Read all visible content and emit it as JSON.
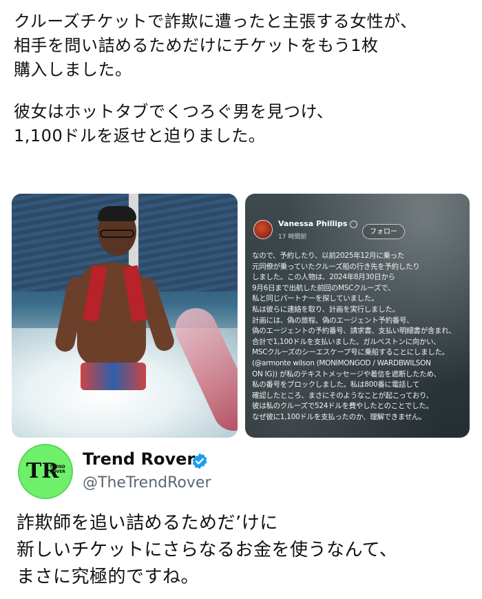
{
  "headline": {
    "lines": [
      "クルーズチケットで詐欺に遭ったと主張する女性が、",
      "相手を問い詰めるためだけにチケットをもう1枚",
      "購入しました。"
    ],
    "lines2": [
      "彼女はホットタブでくつろぐ男を見つけ、",
      "1,100ドルを返せと迫りました。"
    ]
  },
  "fb_post": {
    "author": "Vanessa Phillips",
    "time": "17 時間前",
    "follow_label": "フォロー",
    "lines": [
      "なので、予約したり、以前2025年12月に乗った",
      "元同僚が乗っていたクルーズ船の行き先を予約したり",
      "しました。この人物は、2024年8月30日から",
      "9月6日まで出航した前回のMSCクルーズで、",
      "私と同じパートナーを探していました。",
      "私は彼らに連絡を取り、計画を実行しました。",
      "計画には、偽の旅程、偽のエージェント予約番号、",
      "偽のエージェントの予約番号、請求書、支払い明細書が含まれ、",
      "合計で1,100ドルを支払いました。ガルベストンに向かい、",
      "MSCクルーズのシーエスケープ号に乗船することにしました。",
      "(@armonte wilson (MONIMONGOD / WARDBWILSON",
      "ON IG)) が私のテキストメッセージや着信を遮断したため、",
      "私の番号をブロックしました。私は800番に電話して",
      "確認したところ、まさにそのようなことが起こっており、",
      "彼は私のクルーズで524ドルを費やしたとのことでした。",
      "なぜ彼に1,100ドルを支払ったのか、理解できません。"
    ]
  },
  "tweet": {
    "avatar_text": "TR",
    "avatar_small": "TREND ROVER",
    "display_name": "Trend Rover",
    "handle": "@TheTrendRover",
    "verified_color": "#1d9bf0",
    "lines": [
      "詐欺師を追い詰めるためだ’けに",
      "新しいチケットにさらなるお金を使うなんて、",
      "まさに究極的ですね。"
    ]
  }
}
